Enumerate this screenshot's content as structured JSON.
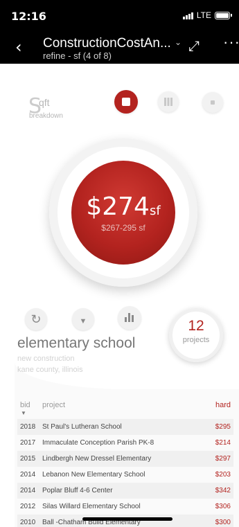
{
  "status_bar": {
    "time": "12:16",
    "network": "LTE"
  },
  "navbar": {
    "back_icon": "back-chevron-icon",
    "title": "ConstructionCostAn...",
    "caret": "⌄",
    "subtitle": "refine - sf (4 of 8)",
    "expand_icon": "expand-arrows-icon",
    "more": "···"
  },
  "header": {
    "logo_big": "S",
    "logo_sup": "qft",
    "logo_small": "breakdown"
  },
  "view_buttons": {
    "active_color": "#b3231f"
  },
  "cost": {
    "price": "$274",
    "unit": "sf",
    "range": "$267-295 sf"
  },
  "tools": {
    "refresh": "↻",
    "pin": "▼"
  },
  "projects": {
    "count": "12",
    "label": "projects"
  },
  "building": {
    "type": "elementary school",
    "construction": "new construction",
    "location": "kane county, illinois"
  },
  "table": {
    "headers": {
      "bid": "bid",
      "project": "project",
      "hard": "hard"
    },
    "sort_indicator": "▼",
    "rows": [
      {
        "year": "2018",
        "project": "St Paul's Lutheran School",
        "hard": "$295"
      },
      {
        "year": "2017",
        "project": "Immaculate Conception Parish PK-8",
        "hard": "$214"
      },
      {
        "year": "2015",
        "project": "Lindbergh New Dressel Elementary",
        "hard": "$297"
      },
      {
        "year": "2014",
        "project": "Lebanon New Elementary School",
        "hard": "$203"
      },
      {
        "year": "2014",
        "project": "Poplar Bluff 4-6 Center",
        "hard": "$342"
      },
      {
        "year": "2012",
        "project": "Silas Willard Elementary School",
        "hard": "$306"
      },
      {
        "year": "2010",
        "project": "Ball -Chatham Build Elementary",
        "hard": "$300"
      }
    ]
  },
  "accent_color": "#b3231f"
}
